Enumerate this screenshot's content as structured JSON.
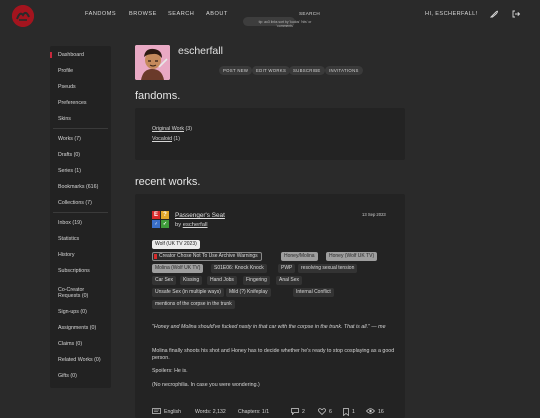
{
  "header": {
    "nav": [
      "FANDOMS",
      "BROWSE",
      "SEARCH",
      "ABOUT"
    ],
    "search": {
      "button": "SEARCH",
      "placeholder": "",
      "tip": "tip: ao3 links sort by 'kudos' 'hits' or 'comments'"
    },
    "greeting": "HI, ESCHERFALL!"
  },
  "sidebar": {
    "group1": [
      "Dashboard",
      "Profile",
      "Pseuds",
      "Preferences",
      "Skins"
    ],
    "group2": [
      "Works (7)",
      "Drafts (0)",
      "Series (1)",
      "Bookmarks (616)",
      "Collections (7)"
    ],
    "group3": [
      "Inbox (19)",
      "Statistics",
      "History",
      "Subscriptions",
      "Co-Creator Requests (0)",
      "Sign-ups (0)",
      "Assignments (0)",
      "Claims (0)",
      "Related Works (0)",
      "Gifts (0)"
    ]
  },
  "profile": {
    "username": "escherfall",
    "actions": [
      "POST NEW",
      "EDIT WORKS",
      "SUBSCRIBE",
      "INVITATIONS"
    ]
  },
  "fandoms": {
    "title": "fandoms.",
    "items": [
      {
        "name": "Original Work",
        "count": "(3)"
      },
      {
        "name": "Vocaloid",
        "count": "(1)"
      }
    ]
  },
  "works": {
    "title": "recent works.",
    "work": {
      "title": "Passenger's Seat",
      "by_prefix": "by ",
      "author": "escherfall",
      "date": "13 Sep 2023",
      "fandom_tag": "Wolf (UK TV 2023)",
      "tags_row1": [
        "Creator Chose Not To Use Archive Warnings",
        "Honey/Molina",
        "Honey (Wolf UK TV)"
      ],
      "tags_row2": [
        "Molina (Wolf UK TV)",
        "S01E06: Knock Knock",
        "PWP",
        "resolving sexual tension"
      ],
      "tags_row3": [
        "Car Sex",
        "Kissing",
        "Hand Jobs",
        "Fingering",
        "Anal Sex"
      ],
      "tags_row4": [
        "Unsafe Sex (in multiple ways)",
        "Mild (?) Knifeplay",
        "Internal Conflict"
      ],
      "tags_row5": [
        "mentions of the corpse in the trunk"
      ],
      "summary": {
        "quote1": "\"Honey and Molina should've fucked nasty in that car with the corpse in the trunk. That is all.\" — me",
        "p1": "Molina finally shoots his shot and Honey has to decide whether he's ready to stop cosplaying as a good person.",
        "p2": "Spoilers: He is.",
        "p3": "(No necrophilia. In case you were wondering.)"
      },
      "stats": {
        "language": "English",
        "words": "Words: 2,132",
        "chapters": "Chapters: 1/1",
        "comments": "2",
        "kudos": "6",
        "bookmarks": "1",
        "hits": "16"
      }
    }
  },
  "colors": {
    "accent": "#c7283c",
    "background": "#2a2a2a",
    "panel": "#232323",
    "logo": "#a3141e"
  }
}
